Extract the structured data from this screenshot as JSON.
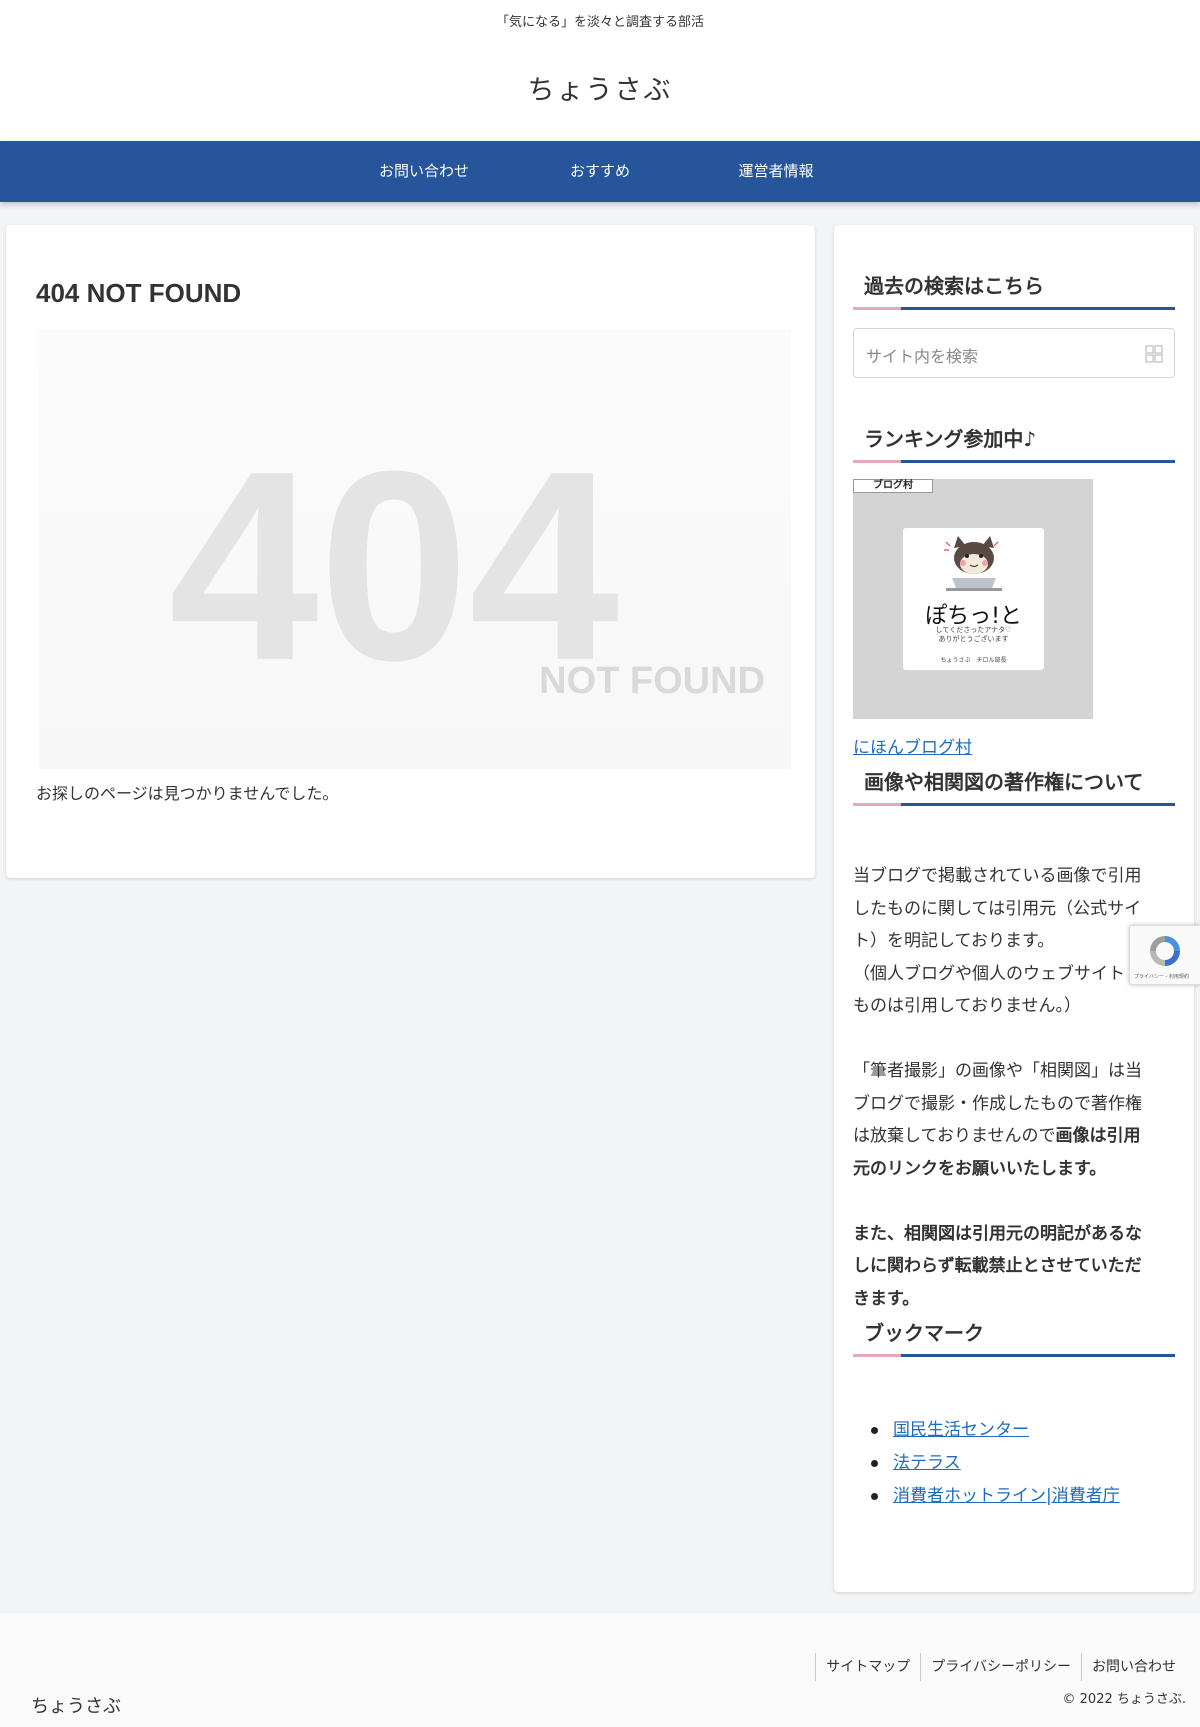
{
  "header": {
    "tagline": "「気になる」を淡々と調査する部活",
    "site_title": "ちょうさぶ"
  },
  "nav": {
    "items": [
      {
        "label": "お問い合わせ"
      },
      {
        "label": "おすすめ"
      },
      {
        "label": "運営者情報"
      }
    ]
  },
  "main": {
    "title": "404 NOT FOUND",
    "image_big": "404",
    "image_small": "NOT FOUND",
    "message": "お探しのページは見つかりませんでした。"
  },
  "sidebar": {
    "search": {
      "title": "過去の検索はこちら",
      "placeholder": "サイト内を検索"
    },
    "ranking": {
      "title": "ランキング参加中♪",
      "badge": "ブログ村",
      "banner_main": "ぽちっ!と",
      "banner_sub_1": "してくださったアナタ♡",
      "banner_sub_2": "ありがとうございます",
      "banner_footer": "ちょうさぶ　チロル部長",
      "link_text": "にほんブログ村"
    },
    "copyright": {
      "title": "画像や相関図の著作権について",
      "p1_lines": [
        "当ブログで掲載されている画像で引用",
        "したものに関しては引用元（公式サイ",
        "ト）を明記しております。",
        "（個人ブログや個人のウェブサイト",
        "ものは引用しておりません。）"
      ],
      "p2_lines": [
        "「筆者撮影」の画像や「相関図」は当",
        "ブログで撮影・作成したもので著作権"
      ],
      "p2_line3_plain": "は放棄しておりませんので",
      "p2_line3_bold": "画像は引用",
      "p2_line4_bold": "元のリンクをお願いいたします。",
      "p3_lines": [
        "また、相関図は引用元の明記があるな",
        "しに関わらず転載禁止とさせていただ",
        "きます。"
      ]
    },
    "bookmarks": {
      "title": "ブックマーク",
      "items": [
        {
          "label": "国民生活センター"
        },
        {
          "label": "法テラス"
        },
        {
          "label": "消費者ホットライン|消費者庁"
        }
      ]
    }
  },
  "recaptcha": {
    "text": "プライバシー - 利用規約"
  },
  "footer": {
    "links": [
      {
        "label": "サイトマップ"
      },
      {
        "label": "プライバシーポリシー"
      },
      {
        "label": "お問い合わせ"
      }
    ],
    "copyright": "© 2022 ちょうさぶ.",
    "logo": "ちょうさぶ"
  },
  "colors": {
    "nav_bg": "#26559b",
    "accent_pink": "#e2a9b7",
    "link": "#1f6bbf",
    "page_bg": "#f3f4f5"
  }
}
